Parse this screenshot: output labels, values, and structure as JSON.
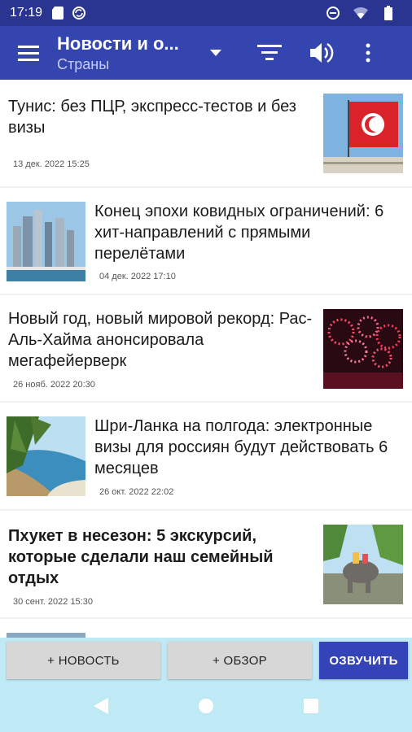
{
  "status_bar": {
    "time": "17:19"
  },
  "app_bar": {
    "title": "Новости и о...",
    "subtitle": "Страны"
  },
  "articles": [
    {
      "title": "Тунис: без ПЦР, экспресс-тестов и без визы",
      "date": "13 дек. 2022  15:25",
      "bold": false
    },
    {
      "title": "Конец эпохи ковидных ограничений: 6 хит-направлений с прямыми перелётами",
      "date": "04 дек. 2022  17:10",
      "bold": false
    },
    {
      "title": "Новый год, новый мировой рекорд: Рас-Аль-Хайма анонсировала мегафейерверк",
      "date": "26 нояб. 2022  20:30",
      "bold": false
    },
    {
      "title": "Шри-Ланка на полгода: электронные визы для россиян будут действовать 6 месяцев",
      "date": "26 окт. 2022  22:02",
      "bold": false
    },
    {
      "title": "Пхукет в несезон: 5 экскурсий, которые сделали наш семейный отдых",
      "date": "30 сент. 2022  15:30",
      "bold": true
    }
  ],
  "bottom_buttons": {
    "add_news": "+ НОВОСТЬ",
    "add_review": "+ ОБЗОР",
    "speak": "ОЗВУЧИТЬ"
  },
  "colors": {
    "status_bar": "#2a3591",
    "app_bar": "#3445b0",
    "accent_button": "#3443b8",
    "bottom_area": "#bfe9f5"
  },
  "icons": {
    "app_bar": [
      "menu-icon",
      "dropdown-arrow-icon",
      "filter-icon",
      "volume-icon",
      "more-vert-icon"
    ],
    "status_bar": [
      "sd-card-icon",
      "no-sync-icon",
      "dnd-icon",
      "wifi-icon",
      "battery-icon"
    ],
    "nav_bar": [
      "back-icon",
      "home-icon",
      "recents-icon"
    ]
  }
}
